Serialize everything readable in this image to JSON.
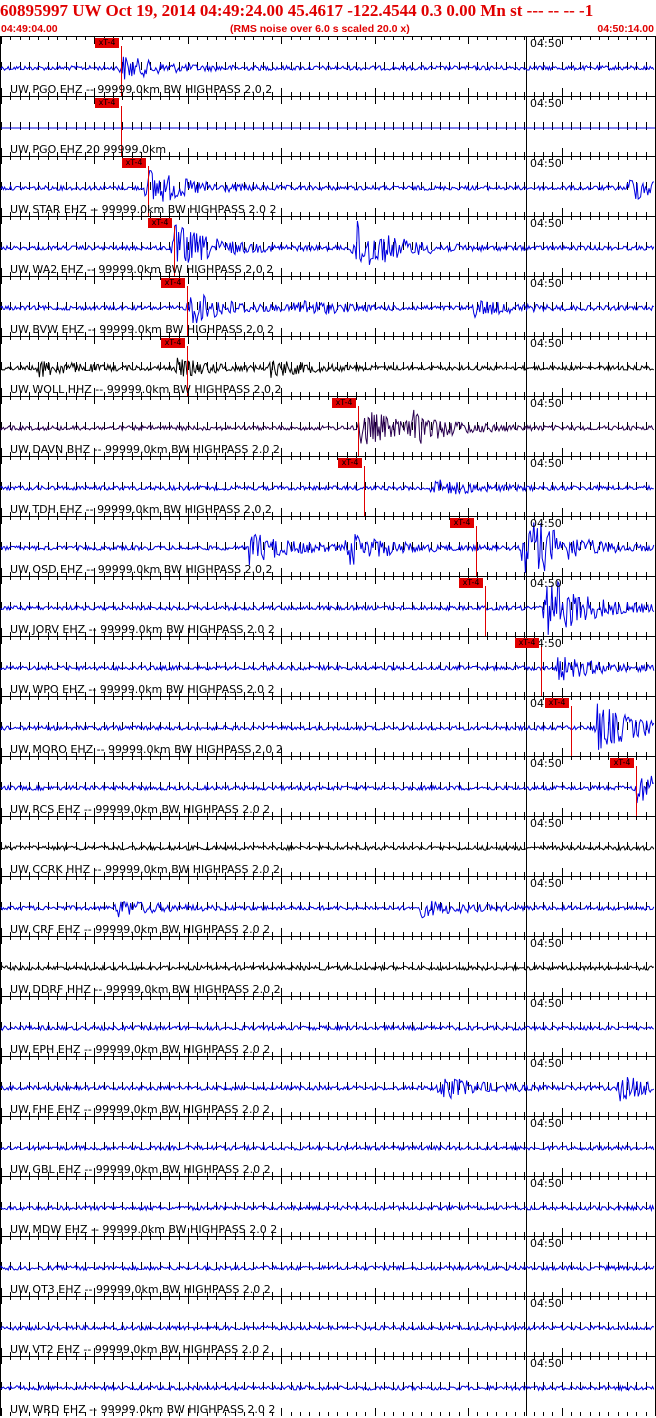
{
  "header": {
    "title": "60895997 UW Oct 19, 2014 04:49:24.00   45.4617 -122.4544  0.3 0.00 Mn st --- -- --  -1",
    "start_time": "04:49:04.00",
    "scale_note": "(RMS noise over 6.0 s scaled 20.0 x)",
    "end_time": "04:50:14.00"
  },
  "time_tick_label": "04:50",
  "pick_label": "xT-4",
  "colors": {
    "title": "#e00000",
    "trace_blue": "#0000e0",
    "trace_black": "#000000",
    "trace_purple": "#2a0050",
    "pick": "#e00000"
  },
  "traces": [
    {
      "label": "UW PGO EHZ -- 99999.0km BW  HIGHPASS  2.0  2",
      "color": "#0000e0",
      "pick": 0.185,
      "bursts": [
        [
          0.185,
          3
        ]
      ]
    },
    {
      "label": "UW PGO EHZ 20 99999.0km",
      "color": "#0000e0",
      "pick": 0.185,
      "bursts": [],
      "flat": true
    },
    {
      "label": "UW STAR EHZ -- 99999.0km BW  HIGHPASS  2.0  2",
      "color": "#0000e0",
      "pick": 0.225,
      "bursts": [
        [
          0.225,
          5
        ],
        [
          0.96,
          3
        ]
      ]
    },
    {
      "label": "UW WA2 EHZ -- 99999.0km BW  HIGHPASS  2.0  2",
      "color": "#0000e0",
      "pick": 0.265,
      "bursts": [
        [
          0.265,
          6
        ],
        [
          0.54,
          7
        ]
      ]
    },
    {
      "label": "UW BVW EHZ -- 99999.0km BW  HIGHPASS  2.0  2",
      "color": "#0000e0",
      "pick": 0.285,
      "bursts": [
        [
          0.29,
          4
        ],
        [
          0.45,
          2
        ],
        [
          0.72,
          2
        ]
      ]
    },
    {
      "label": "UW WOLL HHZ -- 99999.0km BW  HIGHPASS  2.0  2",
      "color": "#000000",
      "pick": 0.285,
      "bursts": [
        [
          0.06,
          2
        ],
        [
          0.27,
          2
        ],
        [
          0.41,
          2
        ]
      ]
    },
    {
      "label": "UW DAVN BHZ -- 99999.0km BW  HIGHPASS  2.0  2",
      "color": "#2a0050",
      "pick": 0.545,
      "bursts": [
        [
          0.55,
          5
        ],
        [
          0.63,
          3
        ]
      ]
    },
    {
      "label": "UW TDH EHZ -- 99999.0km BW  HIGHPASS  2.0  2",
      "color": "#0000e0",
      "pick": 0.555,
      "bursts": [
        [
          0.66,
          2
        ]
      ]
    },
    {
      "label": "UW OSD EHZ -- 99999.0km BW  HIGHPASS  2.0  2",
      "color": "#0000e0",
      "pick": 0.725,
      "bursts": [
        [
          0.38,
          4
        ],
        [
          0.53,
          4
        ],
        [
          0.8,
          9
        ]
      ]
    },
    {
      "label": "UW JORV EHZ -- 99999.0km BW  HIGHPASS  2.0  2",
      "color": "#0000e0",
      "pick": 0.74,
      "bursts": [
        [
          0.83,
          9
        ]
      ]
    },
    {
      "label": "UW WPO EHZ -- 99999.0km BW  HIGHPASS  2.0  2",
      "color": "#0000e0",
      "pick": 0.825,
      "bursts": [
        [
          0.85,
          3
        ]
      ]
    },
    {
      "label": "UW MORO EHZ -- 99999.0km BW  HIGHPASS  2.0  2",
      "color": "#0000e0",
      "pick": 0.87,
      "bursts": [
        [
          0.91,
          6
        ]
      ]
    },
    {
      "label": "UW RCS EHZ -- 99999.0km BW  HIGHPASS  2.0  2",
      "color": "#0000e0",
      "pick": 0.97,
      "bursts": [
        [
          0.97,
          4
        ]
      ]
    },
    {
      "label": "UW CCRK HHZ -- 99999.0km BW  HIGHPASS  2.0  2",
      "color": "#000000",
      "pick": null,
      "bursts": []
    },
    {
      "label": "UW CRF EHZ -- 99999.0km BW  HIGHPASS  2.0  2",
      "color": "#0000e0",
      "pick": null,
      "bursts": [
        [
          0.18,
          2
        ],
        [
          0.64,
          2
        ]
      ]
    },
    {
      "label": "UW DDRF HHZ -- 99999.0km BW  HIGHPASS  2.0  2",
      "color": "#000000",
      "pick": null,
      "bursts": []
    },
    {
      "label": "UW EPH EHZ -- 99999.0km BW  HIGHPASS  2.0  2",
      "color": "#0000e0",
      "pick": null,
      "bursts": []
    },
    {
      "label": "UW FHE EHZ -- 99999.0km BW  HIGHPASS  2.0  2",
      "color": "#0000e0",
      "pick": null,
      "bursts": [
        [
          0.67,
          3
        ],
        [
          0.945,
          3
        ]
      ]
    },
    {
      "label": "UW GBL EHZ -- 99999.0km BW  HIGHPASS  2.0  2",
      "color": "#0000e0",
      "pick": null,
      "bursts": []
    },
    {
      "label": "UW MDW EHZ -- 99999.0km BW  HIGHPASS  2.0  2",
      "color": "#0000e0",
      "pick": null,
      "bursts": []
    },
    {
      "label": "UW OT3 EHZ -- 99999.0km BW  HIGHPASS  2.0  2",
      "color": "#0000e0",
      "pick": null,
      "bursts": []
    },
    {
      "label": "UW VT2 EHZ -- 99999.0km BW  HIGHPASS  2.0  2",
      "color": "#0000e0",
      "pick": null,
      "bursts": []
    },
    {
      "label": "UW WRD EHZ -- 99999.0km BW  HIGHPASS  2.0  2",
      "color": "#0000e0",
      "pick": null,
      "bursts": []
    }
  ]
}
